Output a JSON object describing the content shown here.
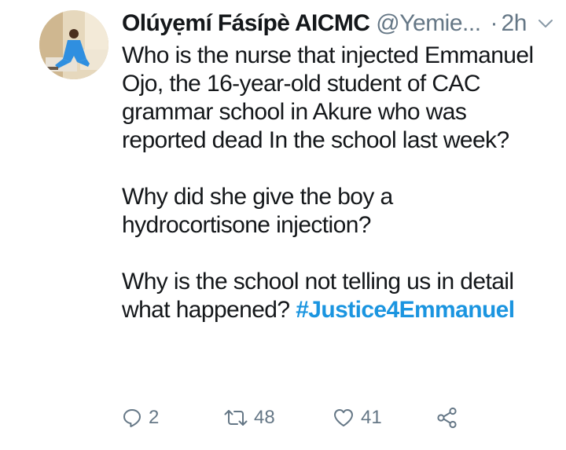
{
  "tweet": {
    "author": {
      "display_name": "Olúyẹmí Fásípè AICMC",
      "handle": "@Yemie...",
      "time": "2h"
    },
    "paragraphs": [
      "Who is the nurse that injected Emmanuel Ojo, the 16-year-old student of CAC grammar school in Akure who was reported dead In the school last week?",
      "Why did she give the boy a hydrocortisone injection?",
      "Why is the school not telling us in detail what happened?"
    ],
    "hashtag": "#Justice4Emmanuel",
    "actions": {
      "reply_count": "2",
      "retweet_count": "48",
      "like_count": "41"
    }
  },
  "colors": {
    "text": "#14171a",
    "muted": "#657786",
    "link": "#1b95e0"
  },
  "icons": [
    "chevron-down-icon",
    "reply-icon",
    "retweet-icon",
    "heart-icon",
    "share-icon"
  ]
}
